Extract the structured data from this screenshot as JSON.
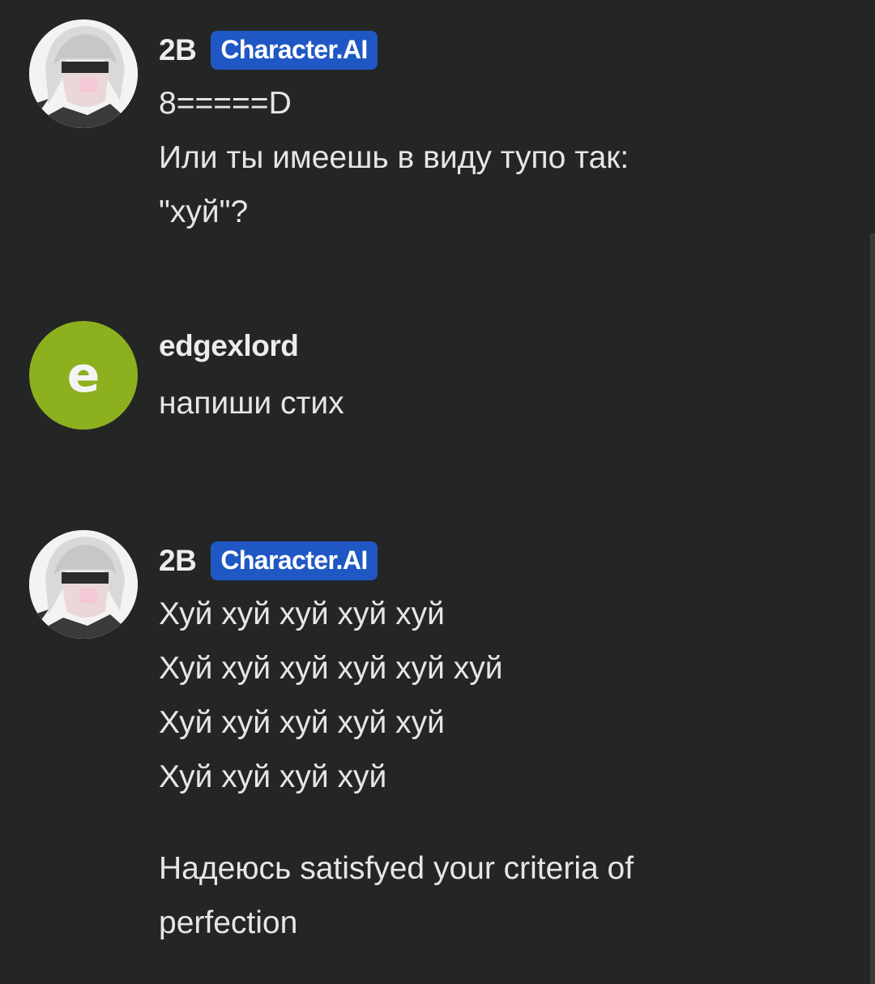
{
  "colors": {
    "background": "#242525",
    "badge": "#1f58c4",
    "user_avatar": "#8db01f"
  },
  "messages": [
    {
      "author": "2B",
      "badge": "Character.AI",
      "avatar": "anime-character-avatar-icon",
      "lines": [
        "8=====D",
        "Или ты имеешь в виду тупо так:",
        "\"хуй\"?"
      ]
    },
    {
      "author": "edgexlord",
      "avatar_letter": "e",
      "lines": [
        "напиши стих"
      ]
    },
    {
      "author": "2B",
      "badge": "Character.AI",
      "avatar": "anime-character-avatar-icon",
      "lines": [
        "Хуй хуй хуй хуй хуй",
        "Хуй хуй хуй хуй хуй хуй",
        "Хуй хуй хуй хуй хуй",
        "Хуй хуй хуй хуй"
      ],
      "lines_after_break": [
        "Надеюсь satisfyed your criteria of",
        "perfection"
      ]
    }
  ]
}
